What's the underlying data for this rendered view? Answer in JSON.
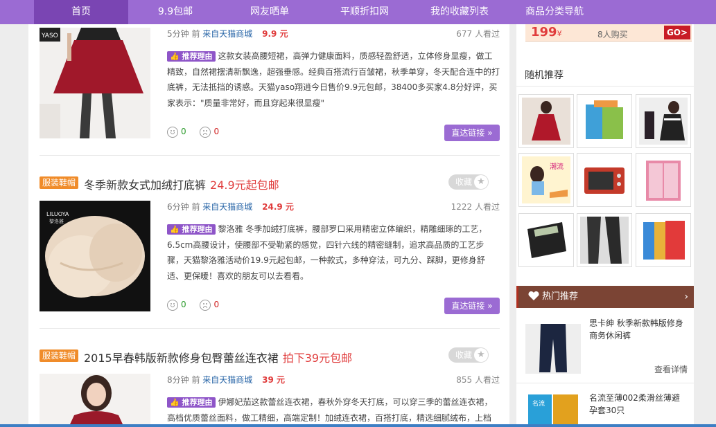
{
  "nav": {
    "items": [
      {
        "label": "首页",
        "active": true
      },
      {
        "label": "9.9包邮"
      },
      {
        "label": "网友晒单"
      },
      {
        "label": "平顺折扣网"
      },
      {
        "label": "我的收藏列表"
      },
      {
        "label": "商品分类导航"
      }
    ]
  },
  "products": [
    {
      "time": "5分钟 前",
      "source": "来自天猫商城",
      "price": "9.9 元",
      "views": "677 人看过",
      "reason_tag": "推荐理由",
      "desc": "这款女装高腰短裙，高弹力健康面料，质感轻盈舒适，立体修身显瘦，做工精致，自然裙摆清新飘逸，超强垂感。经典百搭流行百皱裙，秋季单穿，冬天配合连中的打底裤，无法抵挡的诱惑。天猫yaso翔逍今日售价9.9元包邮，38400多买家4.8分好评，买家表示：\"质量非常好，而且穿起来很显瘦\"",
      "good": "0",
      "bad": "0",
      "link": "直达链接 »"
    },
    {
      "category": "服装鞋帽",
      "title": "冬季新款女式加绒打底裤",
      "title_price": "24.9元起包邮",
      "fav": "收藏",
      "time": "6分钟 前",
      "source": "来自天猫商城",
      "price": "24.9 元",
      "views": "1222 人看过",
      "reason_tag": "推荐理由",
      "desc": "黎洛雅 冬季加绒打底裤，腰部罗口采用精密立体编织，精雕细琢的工艺，6.5cm高腰设计，使腰部不受勒紧的感觉，四针六线的精密缝制，追求高品质的工艺步骤，天猫黎洛雅活动价19.9元起包邮，一种款式，多种穿法，可九分、踩脚，更修身舒适、更保暖！喜欢的朋友可以去看看。",
      "good": "0",
      "bad": "0",
      "link": "直达链接 »"
    },
    {
      "category": "服装鞋帽",
      "title": "2015早春韩版新款修身包臀蕾丝连衣裙",
      "title_price": "拍下39元包邮",
      "fav": "收藏",
      "time": "8分钟 前",
      "source": "来自天猫商城",
      "price": "39 元",
      "views": "855 人看过",
      "reason_tag": "推荐理由",
      "desc": "伊娜妃茄这款蕾丝连衣裙，春秋外穿冬天打底，可以穿三季的蕾丝连衣裙，高档优质蕾丝面料，做工精细，高端定制！加绒连衣裙，百搭打底，精选细腻绒布，上档次!"
    }
  ],
  "sidebar": {
    "buy_price": "199",
    "buy_currency": "¥",
    "buy_count": "8人购买",
    "go": "GO>",
    "random_title": "随机推荐",
    "hot_title": "热门推荐",
    "hot_items": [
      {
        "title": "思卡绅 秋季新款韩版修身商务休闲裤",
        "detail": "查看详情"
      },
      {
        "title": "名流至薄002柔滑丝薄避孕套30只"
      }
    ]
  },
  "colors": {
    "accent": "#9b6bd3",
    "price": "#e03c3c",
    "badge": "#f08c2a",
    "hotbar": "#7b4434"
  }
}
